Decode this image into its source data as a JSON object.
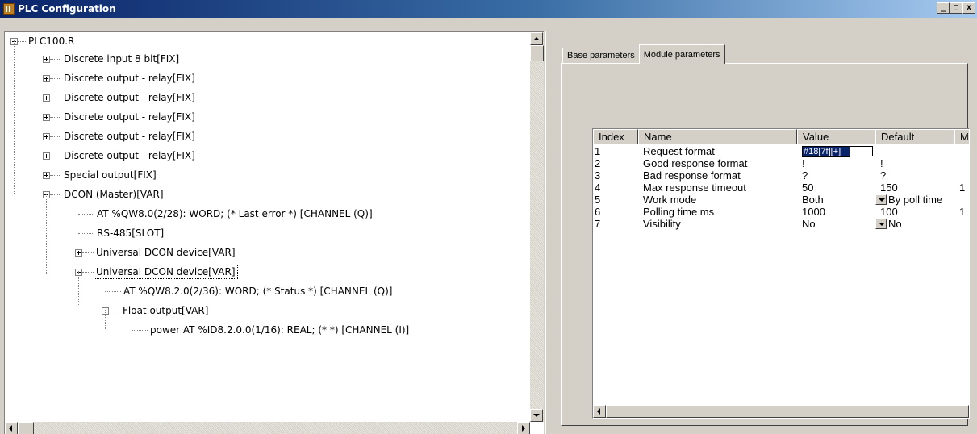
{
  "window": {
    "title": "PLC Configuration",
    "buttons": {
      "minimize": "_",
      "maximize": "□",
      "close": "x"
    }
  },
  "tree": {
    "root": "PLC100.R",
    "nodes": [
      {
        "label": "Discrete input 8 bit[FIX]",
        "expander": "plus"
      },
      {
        "label": "Discrete output - relay[FIX]",
        "expander": "plus"
      },
      {
        "label": "Discrete output - relay[FIX]",
        "expander": "plus"
      },
      {
        "label": "Discrete output - relay[FIX]",
        "expander": "plus"
      },
      {
        "label": "Discrete output - relay[FIX]",
        "expander": "plus"
      },
      {
        "label": "Discrete output - relay[FIX]",
        "expander": "plus"
      },
      {
        "label": "Special output[FIX]",
        "expander": "plus"
      },
      {
        "label": "DCON (Master)[VAR]",
        "expander": "minus"
      },
      {
        "label": "AT %QW8.0(2/28): WORD; (* Last error *) [CHANNEL (Q)]",
        "expander": "none"
      },
      {
        "label": "RS-485[SLOT]",
        "expander": "none"
      },
      {
        "label": "Universal DCON device[VAR]",
        "expander": "plus"
      },
      {
        "label": "Universal DCON device[VAR]",
        "expander": "minus",
        "selected": true
      },
      {
        "label": "AT %QW8.2.0(2/36): WORD; (* Status *) [CHANNEL (Q)]",
        "expander": "none"
      },
      {
        "label": "Float output[VAR]",
        "expander": "minus"
      },
      {
        "label": "power AT %ID8.2.0.0(1/16): REAL; (* *) [CHANNEL (I)]",
        "expander": "none"
      }
    ]
  },
  "tabs": [
    {
      "label": "Base parameters",
      "active": false
    },
    {
      "label": "Module parameters",
      "active": true
    }
  ],
  "params_table": {
    "columns": [
      "Index",
      "Name",
      "Value",
      "Default",
      "M"
    ],
    "rows": [
      {
        "index": "1",
        "name": "Request format",
        "value": "#18[7f][+]",
        "default": "",
        "extra": "",
        "editing": true
      },
      {
        "index": "2",
        "name": "Good response format",
        "value": "!",
        "default": "!",
        "extra": ""
      },
      {
        "index": "3",
        "name": "Bad response format",
        "value": "?",
        "default": "?",
        "extra": ""
      },
      {
        "index": "4",
        "name": "Max response timeout",
        "value": "50",
        "default": "150",
        "extra": "1"
      },
      {
        "index": "5",
        "name": "Work mode",
        "value": "Both",
        "default": "By poll time",
        "extra": "",
        "dropdown": true
      },
      {
        "index": "6",
        "name": "Polling time ms",
        "value": "1000",
        "default": "100",
        "extra": "1"
      },
      {
        "index": "7",
        "name": "Visibility",
        "value": "No",
        "default": "No",
        "extra": "",
        "dropdown": true
      }
    ]
  }
}
